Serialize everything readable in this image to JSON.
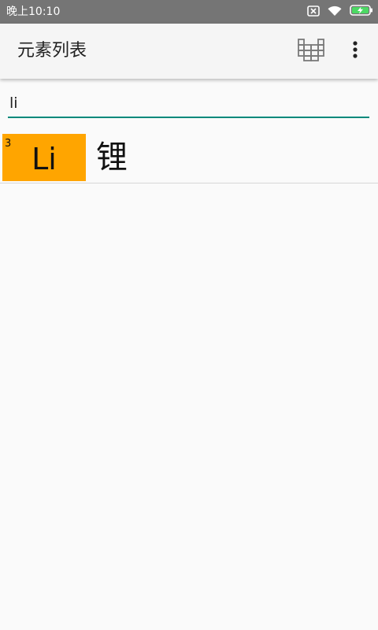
{
  "status_bar": {
    "time": "晚上10:10",
    "icons": [
      "sim-off-icon",
      "wifi-icon",
      "battery-charging-icon"
    ],
    "background": "#757575"
  },
  "app_bar": {
    "title": "元素列表",
    "actions": [
      "periodic-table-icon",
      "more-vert-icon"
    ]
  },
  "search": {
    "value": "li",
    "underline_color": "#00897b"
  },
  "results": [
    {
      "number": "3",
      "symbol": "Li",
      "name": "锂",
      "tile_color": "#ffa500"
    }
  ]
}
